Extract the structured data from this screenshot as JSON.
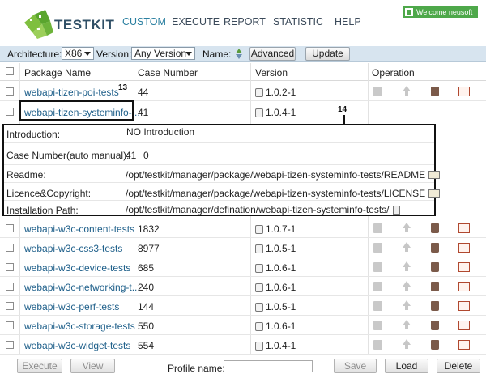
{
  "header": {
    "app_name": "TESTKIT",
    "nav": [
      {
        "label": "CUSTOM",
        "active": true
      },
      {
        "label": "EXECUTE",
        "active": false
      },
      {
        "label": "REPORT",
        "active": false
      },
      {
        "label": "STATISTIC",
        "active": false
      },
      {
        "label": "HELP",
        "active": false
      }
    ],
    "welcome": "Welcome neusoft"
  },
  "filter": {
    "architecture_label": "Architecture:",
    "architecture_value": "X86",
    "version_label": "Version:",
    "version_value": "Any Version",
    "name_label": "Name:",
    "advanced_label": "Advanced",
    "update_label": "Update"
  },
  "table": {
    "headers": {
      "package": "Package Name",
      "case": "Case Number",
      "version": "Version",
      "operation": "Operation"
    },
    "rows_top": [
      {
        "name": "webapi-tizen-poi-tests",
        "cases": "44",
        "version": "1.0.2-1"
      },
      {
        "name": "webapi-tizen-systeminfo-...",
        "cases": "41",
        "version": "1.0.4-1"
      }
    ],
    "rows_bottom": [
      {
        "name": "webapi-w3c-content-tests",
        "cases": "1832",
        "version": "1.0.7-1"
      },
      {
        "name": "webapi-w3c-css3-tests",
        "cases": "8977",
        "version": "1.0.5-1"
      },
      {
        "name": "webapi-w3c-device-tests",
        "cases": "685",
        "version": "1.0.6-1"
      },
      {
        "name": "webapi-w3c-networking-t...",
        "cases": "240",
        "version": "1.0.6-1"
      },
      {
        "name": "webapi-w3c-perf-tests",
        "cases": "144",
        "version": "1.0.5-1"
      },
      {
        "name": "webapi-w3c-storage-tests",
        "cases": "550",
        "version": "1.0.6-1"
      },
      {
        "name": "webapi-w3c-widget-tests",
        "cases": "554",
        "version": "1.0.4-1"
      }
    ]
  },
  "detail": {
    "introduction_label": "Introduction:",
    "introduction_value": "NO Introduction",
    "case_label": "Case Number(auto manual):",
    "case_auto": "41",
    "case_manual": "0",
    "readme_label": "Readme:",
    "readme_value": "/opt/testkit/manager/package/webapi-tizen-systeminfo-tests/README",
    "licence_label": "Licence&Copyright:",
    "licence_value": "/opt/testkit/manager/package/webapi-tizen-systeminfo-tests/LICENSE",
    "install_label": "Installation Path:",
    "install_value": "/opt/testkit/manager/defination/webapi-tizen-systeminfo-tests/"
  },
  "callouts": {
    "a": "13",
    "b": "14"
  },
  "bottom": {
    "execute_label": "Execute",
    "view_label": "View",
    "profile_label": "Profile name:",
    "save_label": "Save",
    "load_label": "Load",
    "delete_label": "Delete"
  }
}
